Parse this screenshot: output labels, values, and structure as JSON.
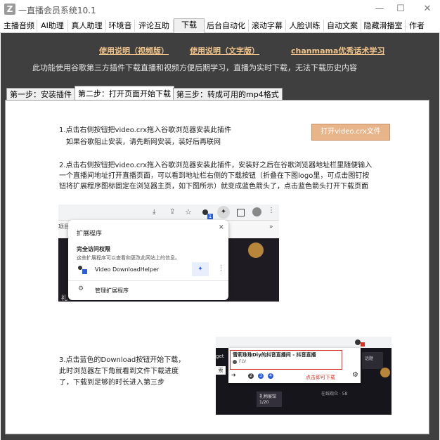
{
  "window": {
    "logo_letter": "Z",
    "title": "一直播会员系统10.1",
    "minimize": "—",
    "maximize": "☐",
    "close": "✕"
  },
  "menu": [
    {
      "label": "主播音频"
    },
    {
      "label": "AI助理"
    },
    {
      "label": "真人助理"
    },
    {
      "label": "环境音"
    },
    {
      "label": "评论互助"
    },
    {
      "label": "下载"
    },
    {
      "label": "后台自动化"
    },
    {
      "label": "滚动字幕"
    },
    {
      "label": "人脸训练"
    },
    {
      "label": "自动文案"
    },
    {
      "label": "隐藏滑播室"
    },
    {
      "label": "作者"
    }
  ],
  "links": {
    "video_guide": "使用说明（视频版）",
    "text_guide": "使用说明（文字版）",
    "course": "chanmama优秀话术学习"
  },
  "notice": "此功能使用谷歌第三方插件下载直播和视频方便后期学习，直播为实时下载，无法下载历史内容",
  "subtabs": [
    {
      "label": "第一步：安装插件"
    },
    {
      "label": "第二步：打开页面开始下载"
    },
    {
      "label": "第三步：转成可用的mp4格式"
    }
  ],
  "step1": {
    "line1": "1.点击右侧按钮把video.crx拖入谷歌浏览器安装此插件",
    "line2": "如果谷歌阻止安装，请先断网安装，装好后再联网",
    "button": "打开video.crx文件"
  },
  "step2": {
    "line1": "2.点击右侧按钮把video.crx拖入谷歌浏览器安装此插件，安装好之后在谷歌浏览器地址栏里随便输入",
    "line2": "一个直播间地址打开直播页面，可以看到地址栏右侧的下载按钮（折叠在下图logo里，可点击图钉按",
    "line3": "钮将扩展程序图标固定在浏览器主页，如下图所示）就变成蓝色箭头了，点击蓝色箭头打开下载页面"
  },
  "screenshot1": {
    "tab_text": "项目",
    "ext_title": "扩展程序",
    "access_title": "完全访问权限",
    "access_desc": "这些扩展程序可以查看和更改此网站上的信息。",
    "ext_name": "Video DownloadHelper",
    "manage": "管理扩展程序",
    "badge": "1",
    "side_text": "礼"
  },
  "step3": {
    "line1": "3.点击蓝色的Download按钮开始下载，",
    "line2": "此时浏览器左下角就看到文件下载进度",
    "line3": "了，下载到足够的时长进入第三步"
  },
  "screenshot2": {
    "stream_title": "雪莉珠珠Diy的抖音直播间 - 抖音直播",
    "format": "FLV",
    "hint": "点击即可下载",
    "left_text": "get",
    "left_btn": "索",
    "counts": [
      "2",
      "3",
      "4"
    ],
    "bottom_label": "在线观众 · 58",
    "side_note": "礼物展馆",
    "side_num": "1/20",
    "room_tag": "话题"
  }
}
